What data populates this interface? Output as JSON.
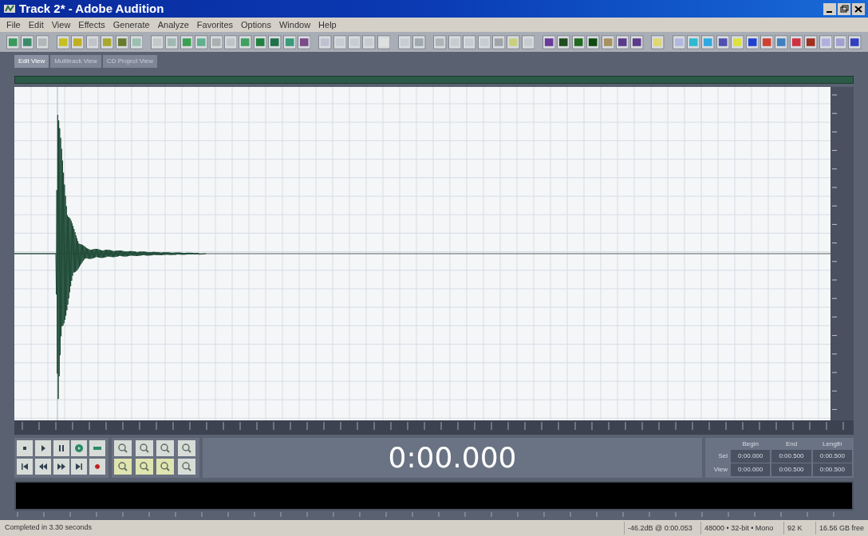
{
  "window": {
    "title": "Track 2* - Adobe Audition"
  },
  "menu": [
    "File",
    "Edit",
    "View",
    "Effects",
    "Generate",
    "Analyze",
    "Favorites",
    "Options",
    "Window",
    "Help"
  ],
  "view_tabs": [
    {
      "label": "Edit View",
      "selected": true
    },
    {
      "label": "Multitrack View",
      "selected": false
    },
    {
      "label": "CD Project View",
      "selected": false
    }
  ],
  "time_display": "0:00.000",
  "selection": {
    "columns": [
      "Begin",
      "End",
      "Length"
    ],
    "rows": [
      {
        "label": "Sel",
        "values": [
          "0:00.000",
          "0:00.500",
          "0:00.500"
        ]
      },
      {
        "label": "View",
        "values": [
          "0:00.000",
          "0:00.500",
          "0:00.500"
        ]
      }
    ]
  },
  "status_bar": {
    "message": "Completed in 3.30 seconds",
    "fields": [
      "-46.2dB @ 0:00.053",
      "48000 • 32-bit • Mono",
      "92 K",
      "16.56 GB free"
    ]
  }
}
